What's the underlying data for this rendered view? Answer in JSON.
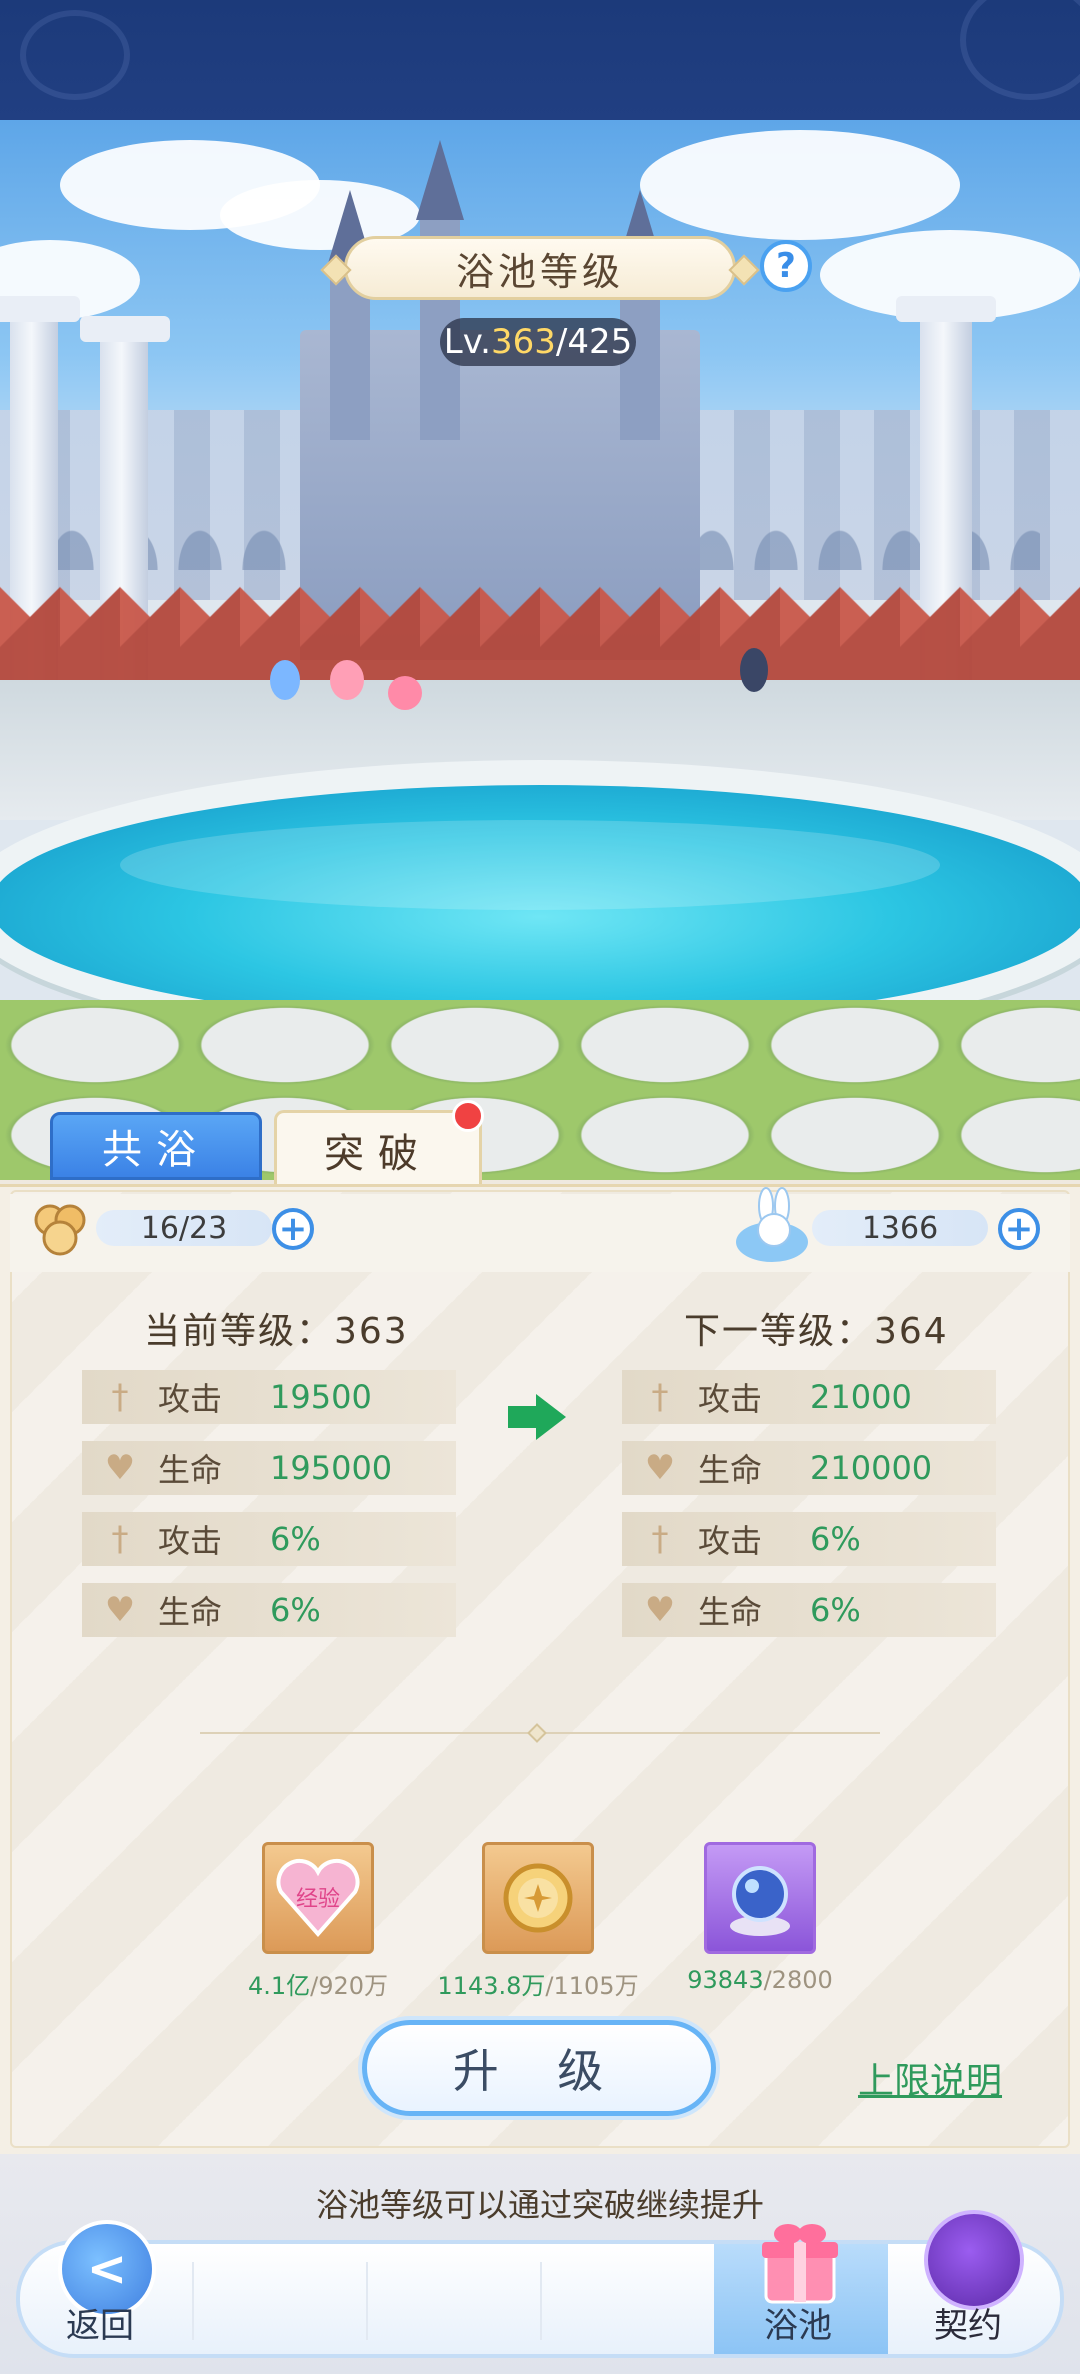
{
  "pool": {
    "title": "浴池等级",
    "level_prefix": "Lv.",
    "level_current": "363",
    "level_max": "/425",
    "help_symbol": "?"
  },
  "tabs": [
    {
      "label": "共浴",
      "active": false
    },
    {
      "label": "突破",
      "active": true,
      "badge": true
    }
  ],
  "resources": {
    "left": {
      "icon": "gold-coins-icon",
      "value": "16/23"
    },
    "right": {
      "icon": "bubble-bunny-icon",
      "value": "1366"
    },
    "plus_symbol": "+"
  },
  "current_level": {
    "heading": "当前等级：363",
    "stats": [
      {
        "icon": "sword-icon",
        "name": "攻击",
        "value": "19500"
      },
      {
        "icon": "heart-icon",
        "name": "生命",
        "value": "195000"
      },
      {
        "icon": "sword-icon",
        "name": "攻击",
        "value": "6%"
      },
      {
        "icon": "heart-icon",
        "name": "生命",
        "value": "6%"
      }
    ]
  },
  "next_level": {
    "heading": "下一等级：364",
    "stats": [
      {
        "icon": "sword-icon",
        "name": "攻击",
        "value": "21000"
      },
      {
        "icon": "heart-icon",
        "name": "生命",
        "value": "210000"
      },
      {
        "icon": "sword-icon",
        "name": "攻击",
        "value": "6%"
      },
      {
        "icon": "heart-icon",
        "name": "生命",
        "value": "6%"
      }
    ]
  },
  "costs": [
    {
      "icon": "exp-heart-crystal-icon",
      "icon_text": "经验",
      "have": "4.1亿",
      "need": "/920万"
    },
    {
      "icon": "gold-coin-icon",
      "have": "1143.8万",
      "need": "/1105万"
    },
    {
      "icon": "crystal-orb-icon",
      "have": "93843",
      "need": "/2800"
    }
  ],
  "actions": {
    "upgrade": "升 级",
    "limit_info": "上限说明"
  },
  "hint": "浴池等级可以通过突破继续提升",
  "nav": {
    "back": "返回",
    "pool": "浴池",
    "contract": "契约"
  },
  "colors": {
    "accent_blue": "#3d8fe6",
    "stat_green": "#2f9a5c",
    "badge_red": "#f04242",
    "header_navy": "#1c3a7a"
  }
}
